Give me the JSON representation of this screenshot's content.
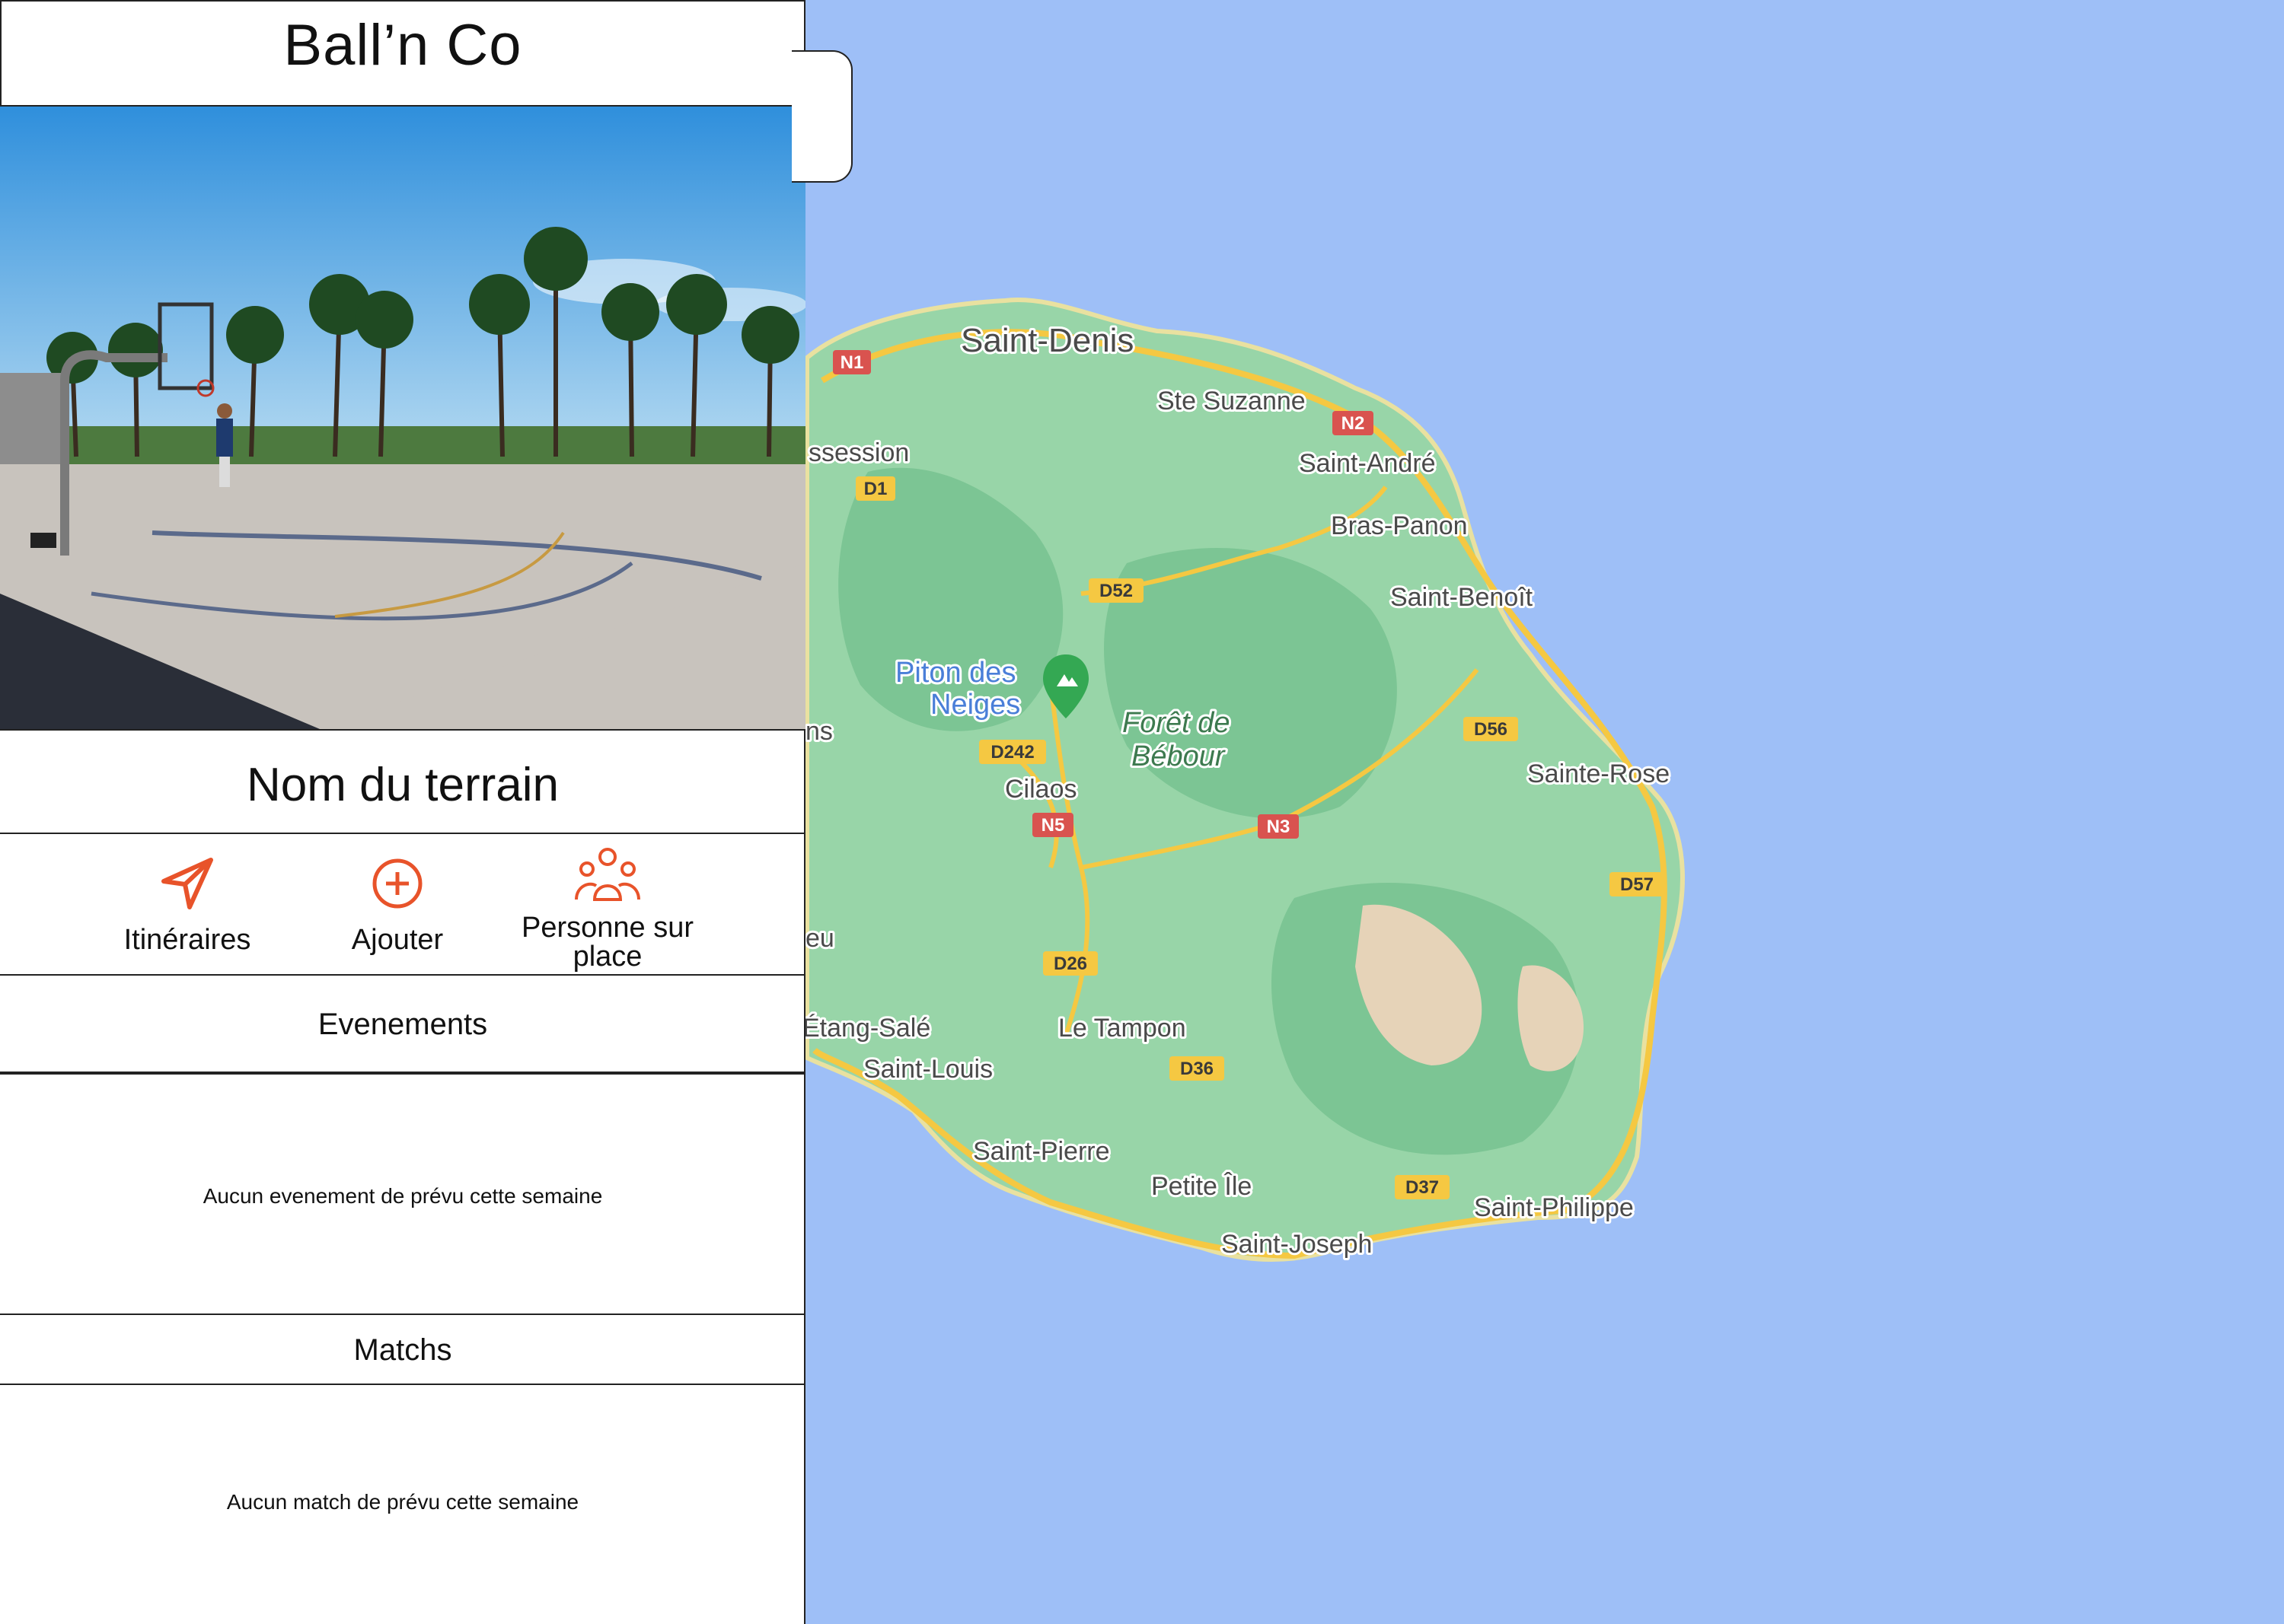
{
  "app": {
    "title": "Ball’n Co"
  },
  "court": {
    "name": "Nom du terrain"
  },
  "actions": [
    {
      "label": "Itinéraires",
      "icon": "navigation-arrow-icon"
    },
    {
      "label": "Ajouter",
      "icon": "add-circle-icon"
    },
    {
      "label": "Personne sur place",
      "icon": "people-group-icon"
    }
  ],
  "events": {
    "title": "Evenements",
    "empty_message": "Aucun evenement de prévu cette semaine"
  },
  "matches": {
    "title": "Matchs",
    "empty_message": "Aucun match de prévu cette semaine"
  },
  "map": {
    "places": [
      "Saint-Denis",
      "Ste Suzanne",
      "Saint-André",
      "Bras-Panon",
      "Saint-Benoît",
      "Sainte-Rose",
      "Saint-Philippe",
      "Saint-Joseph",
      "Petite Île",
      "Saint-Pierre",
      "Le Tampon",
      "Saint-Louis",
      "Étang-Salé",
      "Cilaos",
      "ssession",
      "ns",
      "eu"
    ],
    "landmarks": {
      "peak_line1": "Piton des",
      "peak_line2": "Neiges",
      "forest_line1": "Forêt de",
      "forest_line2": "Bébour"
    },
    "roads": [
      "N1",
      "N2",
      "N3",
      "N5",
      "D1",
      "D52",
      "D242",
      "D56",
      "D57",
      "D26",
      "D36",
      "D37"
    ],
    "colors": {
      "sea": "#9ebff7",
      "land": "#98d5a8",
      "forest": "#7cc594",
      "road": "#f5c842",
      "national_road": "#d9534f",
      "accent": "#e8532a"
    }
  }
}
